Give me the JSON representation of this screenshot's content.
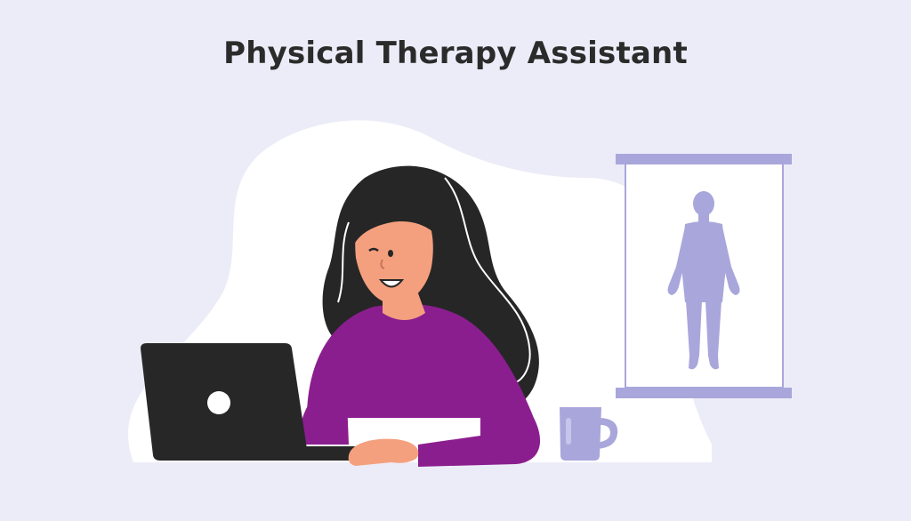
{
  "page": {
    "title": "Physical Therapy Assistant"
  },
  "colors": {
    "background": "#ECECF8",
    "blob": "#FFFFFF",
    "sweater": "#8B1E8F",
    "hair": "#262626",
    "skin": "#F4A07E",
    "laptop": "#272727",
    "accent_lavender": "#A9A6DB"
  },
  "illustration": {
    "elements": [
      "woman-figure",
      "laptop-icon",
      "mug-icon",
      "anatomy-chart",
      "human-body-silhouette-icon"
    ]
  }
}
